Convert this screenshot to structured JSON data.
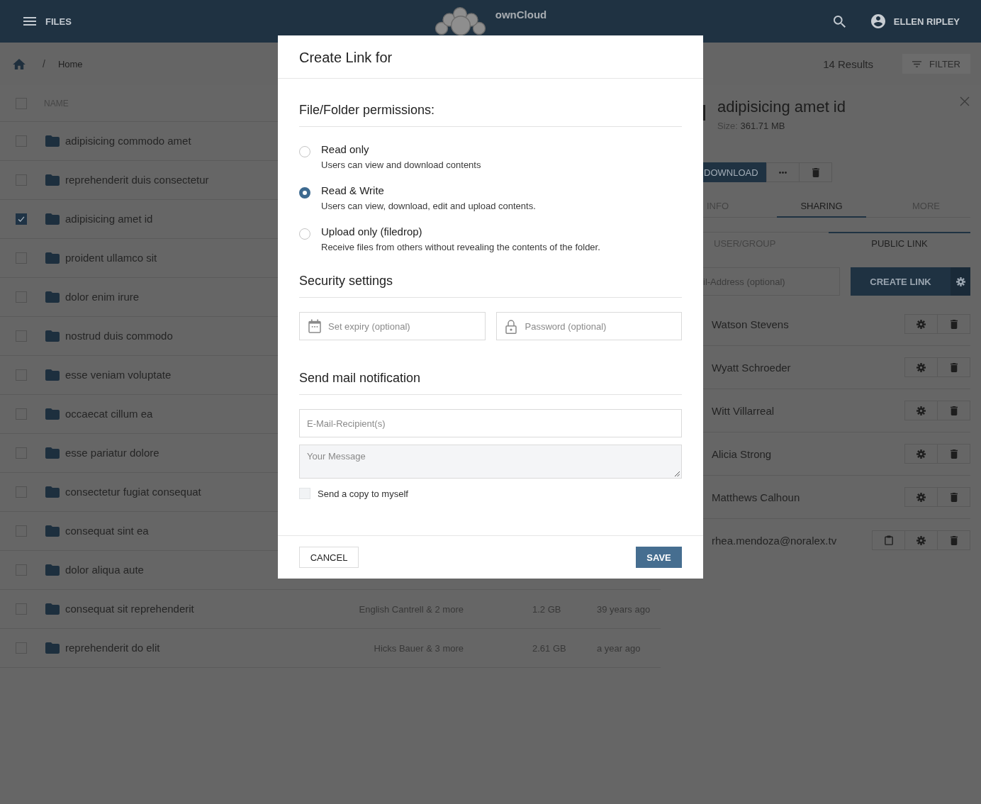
{
  "header": {
    "menu_label": "FILES",
    "brand": "ownCloud",
    "user": "ELLEN RIPLEY"
  },
  "breadcrumb": {
    "separator": "/",
    "items": [
      "Home"
    ]
  },
  "toolbar": {
    "results": "14 Results",
    "filter": "FILTER"
  },
  "file_list": {
    "select_all_checked": false,
    "columns": [
      "NAME"
    ],
    "rows": [
      {
        "name": "adipisicing commodo amet",
        "checked": false
      },
      {
        "name": "reprehenderit duis consectetur",
        "checked": false
      },
      {
        "name": "adipisicing amet id",
        "checked": true
      },
      {
        "name": "proident ullamco sit",
        "checked": false
      },
      {
        "name": "dolor enim irure",
        "checked": false
      },
      {
        "name": "nostrud duis commodo",
        "checked": false
      },
      {
        "name": "esse veniam voluptate",
        "checked": false
      },
      {
        "name": "occaecat cillum ea",
        "checked": false
      },
      {
        "name": "esse pariatur dolore",
        "checked": false
      },
      {
        "name": "consectetur fugiat consequat",
        "checked": false
      },
      {
        "name": "consequat sint ea",
        "checked": false
      },
      {
        "name": "dolor aliqua aute",
        "checked": false
      },
      {
        "name": "consequat sit reprehenderit",
        "checked": false,
        "shared_with": "English Cantrell & 2 more",
        "size": "1.2 GB",
        "modified": "39 years ago"
      },
      {
        "name": "reprehenderit do elit",
        "checked": false,
        "shared_with": "Hicks Bauer & 3 more",
        "size": "2.61 GB",
        "modified": "a year ago"
      }
    ]
  },
  "details": {
    "title": "adipisicing amet id",
    "size_label": "Size:",
    "size_value": "361.71 MB",
    "actions": [
      {
        "kind": "download",
        "label": "DOWNLOAD"
      },
      {
        "kind": "more"
      },
      {
        "kind": "delete"
      }
    ],
    "tabs": [
      {
        "label": "INFO",
        "selected": false
      },
      {
        "label": "SHARING",
        "selected": true
      },
      {
        "label": "MORE",
        "selected": false
      }
    ],
    "share_tabs": [
      {
        "label": "USER/GROUP",
        "selected": false
      },
      {
        "label": "PUBLIC LINK",
        "selected": true
      }
    ],
    "email_placeholder": "il-Address (optional)",
    "create_link": "CREATE LINK",
    "shares": [
      {
        "name": "Watson Stevens",
        "kind": "user"
      },
      {
        "name": "Wyatt Schroeder",
        "kind": "user"
      },
      {
        "name": "Witt Villarreal",
        "kind": "user"
      },
      {
        "name": "Alicia Strong",
        "kind": "user"
      },
      {
        "name": "Matthews Calhoun",
        "kind": "user"
      },
      {
        "name": "rhea.mendoza@noralex.tv",
        "kind": "email"
      }
    ]
  },
  "dialog": {
    "title": "Create Link for",
    "permissions_heading": "File/Folder permissions:",
    "permissions": [
      {
        "label": "Read only",
        "description": "Users can view and download contents",
        "selected": false
      },
      {
        "label": "Read & Write",
        "description": "Users can view, download, edit and upload contents.",
        "selected": true
      },
      {
        "label": "Upload only (filedrop)",
        "description": "Receive files from others without revealing the contents of the folder.",
        "selected": false
      }
    ],
    "security_heading": "Security settings",
    "expiry_placeholder": "Set expiry (optional)",
    "password_placeholder": "Password (optional)",
    "mail_heading": "Send mail notification",
    "recipients_placeholder": "E-Mail-Recipient(s)",
    "message_placeholder": "Your Message",
    "copy_label": "Send a copy to myself",
    "copy_checked": false,
    "cancel": "CANCEL",
    "save": "SAVE"
  }
}
